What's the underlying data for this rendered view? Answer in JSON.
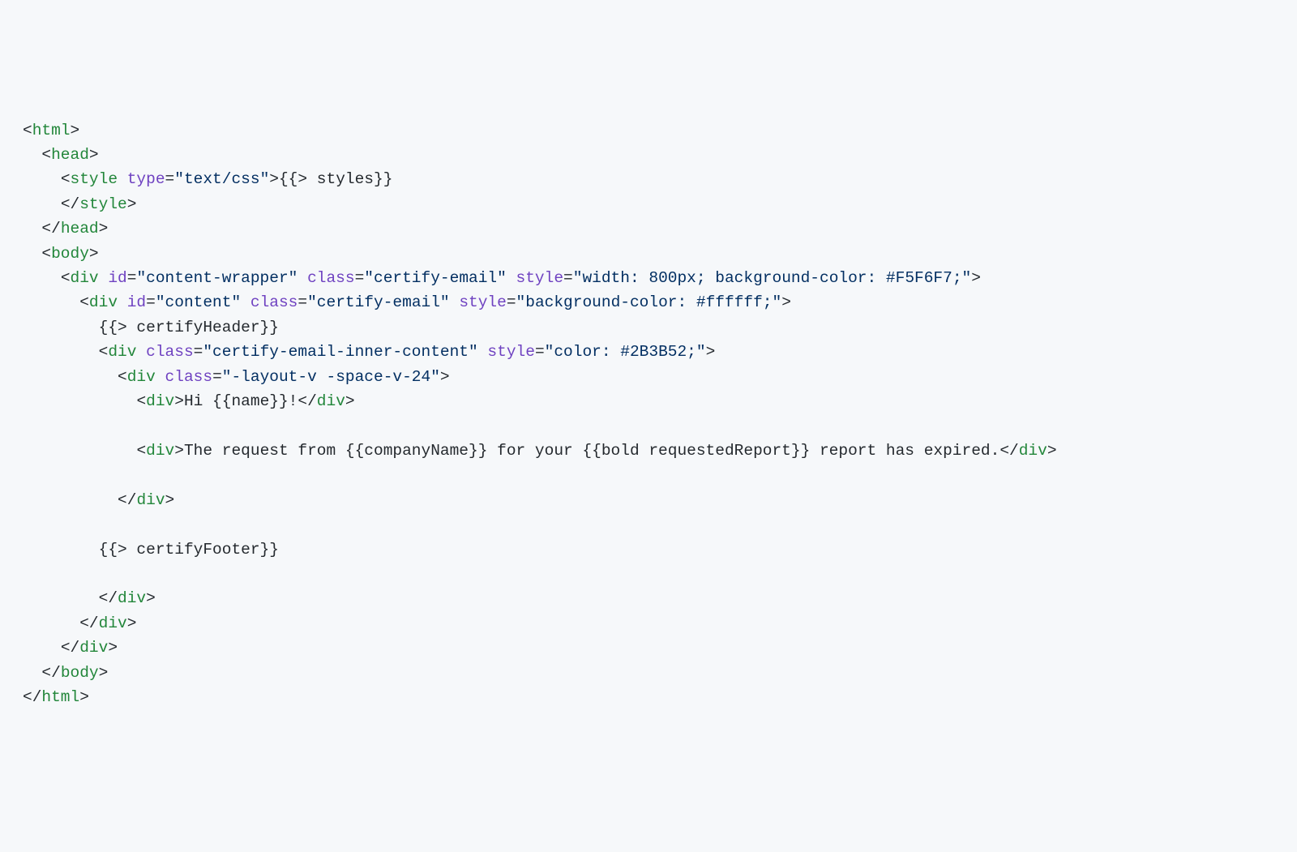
{
  "lines": [
    {
      "indent": 0,
      "tokens": [
        {
          "t": "punct",
          "v": "<"
        },
        {
          "t": "tag",
          "v": "html"
        },
        {
          "t": "punct",
          "v": ">"
        }
      ]
    },
    {
      "indent": 1,
      "tokens": [
        {
          "t": "punct",
          "v": "<"
        },
        {
          "t": "tag",
          "v": "head"
        },
        {
          "t": "punct",
          "v": ">"
        }
      ]
    },
    {
      "indent": 2,
      "tokens": [
        {
          "t": "punct",
          "v": "<"
        },
        {
          "t": "tag",
          "v": "style"
        },
        {
          "t": "text",
          "v": " "
        },
        {
          "t": "attr-name",
          "v": "type"
        },
        {
          "t": "punct",
          "v": "="
        },
        {
          "t": "attr-value",
          "v": "\"text/css\""
        },
        {
          "t": "punct",
          "v": ">"
        },
        {
          "t": "text",
          "v": "{{> styles}}"
        }
      ]
    },
    {
      "indent": 2,
      "tokens": [
        {
          "t": "punct",
          "v": "</"
        },
        {
          "t": "tag",
          "v": "style"
        },
        {
          "t": "punct",
          "v": ">"
        }
      ]
    },
    {
      "indent": 1,
      "tokens": [
        {
          "t": "punct",
          "v": "</"
        },
        {
          "t": "tag",
          "v": "head"
        },
        {
          "t": "punct",
          "v": ">"
        }
      ]
    },
    {
      "indent": 1,
      "tokens": [
        {
          "t": "punct",
          "v": "<"
        },
        {
          "t": "tag",
          "v": "body"
        },
        {
          "t": "punct",
          "v": ">"
        }
      ]
    },
    {
      "indent": 2,
      "tokens": [
        {
          "t": "punct",
          "v": "<"
        },
        {
          "t": "tag",
          "v": "div"
        },
        {
          "t": "text",
          "v": " "
        },
        {
          "t": "attr-name",
          "v": "id"
        },
        {
          "t": "punct",
          "v": "="
        },
        {
          "t": "attr-value",
          "v": "\"content-wrapper\""
        },
        {
          "t": "text",
          "v": " "
        },
        {
          "t": "attr-name",
          "v": "class"
        },
        {
          "t": "punct",
          "v": "="
        },
        {
          "t": "attr-value",
          "v": "\"certify-email\""
        },
        {
          "t": "text",
          "v": " "
        },
        {
          "t": "attr-name",
          "v": "style"
        },
        {
          "t": "punct",
          "v": "="
        },
        {
          "t": "attr-value",
          "v": "\"width: 800px; background-color: #F5F6F7;\""
        },
        {
          "t": "punct",
          "v": ">"
        }
      ]
    },
    {
      "indent": 3,
      "tokens": [
        {
          "t": "punct",
          "v": "<"
        },
        {
          "t": "tag",
          "v": "div"
        },
        {
          "t": "text",
          "v": " "
        },
        {
          "t": "attr-name",
          "v": "id"
        },
        {
          "t": "punct",
          "v": "="
        },
        {
          "t": "attr-value",
          "v": "\"content\""
        },
        {
          "t": "text",
          "v": " "
        },
        {
          "t": "attr-name",
          "v": "class"
        },
        {
          "t": "punct",
          "v": "="
        },
        {
          "t": "attr-value",
          "v": "\"certify-email\""
        },
        {
          "t": "text",
          "v": " "
        },
        {
          "t": "attr-name",
          "v": "style"
        },
        {
          "t": "punct",
          "v": "="
        },
        {
          "t": "attr-value",
          "v": "\"background-color: #ffffff;\""
        },
        {
          "t": "punct",
          "v": ">"
        }
      ]
    },
    {
      "indent": 4,
      "tokens": [
        {
          "t": "text",
          "v": "{{> certifyHeader}}"
        }
      ]
    },
    {
      "indent": 4,
      "tokens": [
        {
          "t": "punct",
          "v": "<"
        },
        {
          "t": "tag",
          "v": "div"
        },
        {
          "t": "text",
          "v": " "
        },
        {
          "t": "attr-name",
          "v": "class"
        },
        {
          "t": "punct",
          "v": "="
        },
        {
          "t": "attr-value",
          "v": "\"certify-email-inner-content\""
        },
        {
          "t": "text",
          "v": " "
        },
        {
          "t": "attr-name",
          "v": "style"
        },
        {
          "t": "punct",
          "v": "="
        },
        {
          "t": "attr-value",
          "v": "\"color: #2B3B52;\""
        },
        {
          "t": "punct",
          "v": ">"
        }
      ]
    },
    {
      "indent": 5,
      "tokens": [
        {
          "t": "punct",
          "v": "<"
        },
        {
          "t": "tag",
          "v": "div"
        },
        {
          "t": "text",
          "v": " "
        },
        {
          "t": "attr-name",
          "v": "class"
        },
        {
          "t": "punct",
          "v": "="
        },
        {
          "t": "attr-value",
          "v": "\"-layout-v -space-v-24\""
        },
        {
          "t": "punct",
          "v": ">"
        }
      ]
    },
    {
      "indent": 6,
      "tokens": [
        {
          "t": "punct",
          "v": "<"
        },
        {
          "t": "tag",
          "v": "div"
        },
        {
          "t": "punct",
          "v": ">"
        },
        {
          "t": "text",
          "v": "Hi {{name}}!"
        },
        {
          "t": "punct",
          "v": "</"
        },
        {
          "t": "tag",
          "v": "div"
        },
        {
          "t": "punct",
          "v": ">"
        }
      ]
    },
    {
      "indent": 0,
      "tokens": [
        {
          "t": "text",
          "v": ""
        }
      ]
    },
    {
      "indent": 6,
      "tokens": [
        {
          "t": "punct",
          "v": "<"
        },
        {
          "t": "tag",
          "v": "div"
        },
        {
          "t": "punct",
          "v": ">"
        },
        {
          "t": "text",
          "v": "The request from {{companyName}} for your {{bold requestedReport}} report has expired."
        },
        {
          "t": "punct",
          "v": "</"
        },
        {
          "t": "tag",
          "v": "div"
        },
        {
          "t": "punct",
          "v": ">"
        }
      ]
    },
    {
      "indent": 0,
      "tokens": [
        {
          "t": "text",
          "v": ""
        }
      ]
    },
    {
      "indent": 5,
      "tokens": [
        {
          "t": "punct",
          "v": "</"
        },
        {
          "t": "tag",
          "v": "div"
        },
        {
          "t": "punct",
          "v": ">"
        }
      ]
    },
    {
      "indent": 0,
      "tokens": [
        {
          "t": "text",
          "v": ""
        }
      ]
    },
    {
      "indent": 4,
      "tokens": [
        {
          "t": "text",
          "v": "{{> certifyFooter}}"
        }
      ]
    },
    {
      "indent": 0,
      "tokens": [
        {
          "t": "text",
          "v": ""
        }
      ]
    },
    {
      "indent": 4,
      "tokens": [
        {
          "t": "punct",
          "v": "</"
        },
        {
          "t": "tag",
          "v": "div"
        },
        {
          "t": "punct",
          "v": ">"
        }
      ]
    },
    {
      "indent": 3,
      "tokens": [
        {
          "t": "punct",
          "v": "</"
        },
        {
          "t": "tag",
          "v": "div"
        },
        {
          "t": "punct",
          "v": ">"
        }
      ]
    },
    {
      "indent": 2,
      "tokens": [
        {
          "t": "punct",
          "v": "</"
        },
        {
          "t": "tag",
          "v": "div"
        },
        {
          "t": "punct",
          "v": ">"
        }
      ]
    },
    {
      "indent": 1,
      "tokens": [
        {
          "t": "punct",
          "v": "</"
        },
        {
          "t": "tag",
          "v": "body"
        },
        {
          "t": "punct",
          "v": ">"
        }
      ]
    },
    {
      "indent": 0,
      "tokens": [
        {
          "t": "punct",
          "v": "</"
        },
        {
          "t": "tag",
          "v": "html"
        },
        {
          "t": "punct",
          "v": ">"
        }
      ]
    }
  ],
  "indentUnit": "  "
}
